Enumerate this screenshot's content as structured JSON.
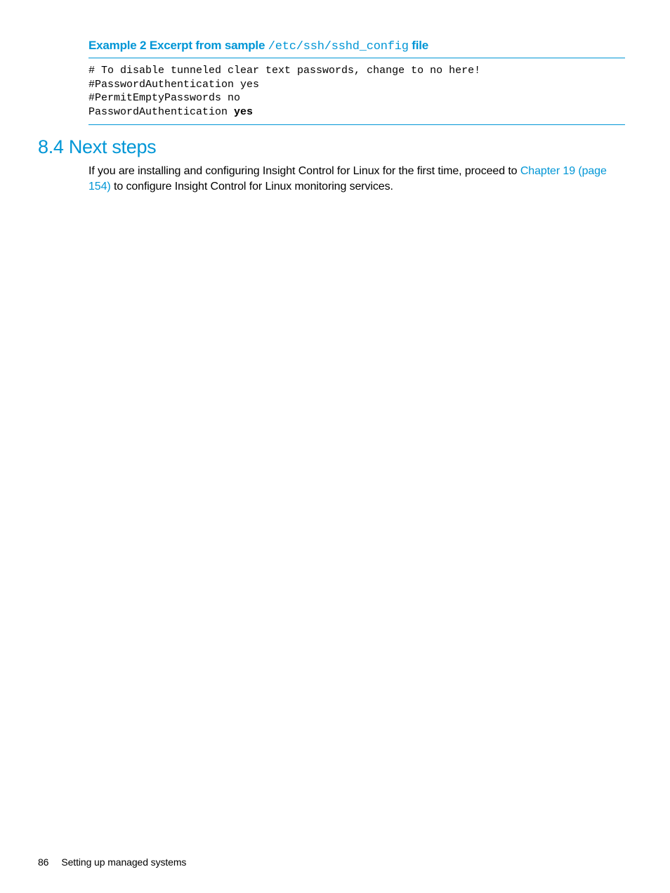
{
  "example": {
    "title_prefix": "Example 2 Excerpt from sample ",
    "title_path": "/etc/ssh/sshd_config",
    "title_suffix": " file",
    "code_line1": "# To disable tunneled clear text passwords, change to no here!",
    "code_line2": "#PasswordAuthentication yes",
    "code_line3": "#PermitEmptyPasswords no",
    "code_line4_a": "PasswordAuthentication ",
    "code_line4_b": "yes"
  },
  "section": {
    "heading": "8.4 Next steps",
    "para_before_link": "If you are installing and configuring Insight Control for Linux for the first time, proceed to ",
    "link_text": "Chapter 19 (page 154)",
    "para_after_link": " to configure Insight Control for Linux monitoring services."
  },
  "footer": {
    "page_number": "86",
    "section_title": "Setting up managed systems"
  }
}
